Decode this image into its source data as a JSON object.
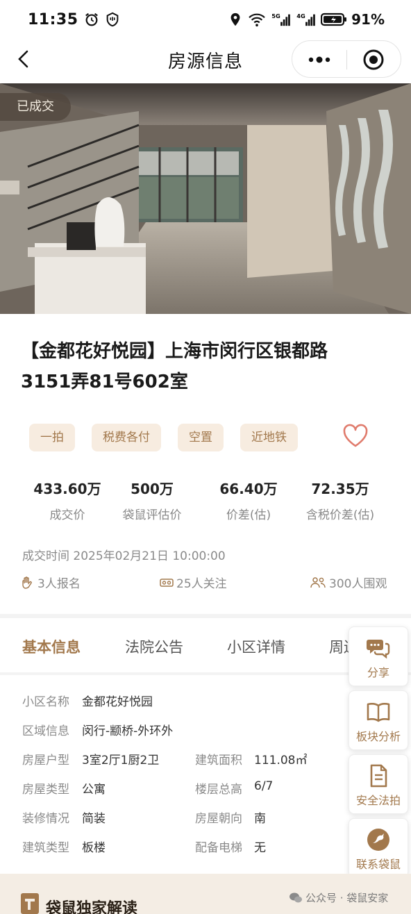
{
  "status_bar": {
    "time": "11:35",
    "battery": "91%"
  },
  "nav": {
    "title": "房源信息"
  },
  "photo": {
    "status_tag": "已成交"
  },
  "listing": {
    "title_line1": "【金都花好悦园】上海市闵行区银都路",
    "title_line2": "3151弄81号602室",
    "tags": [
      "一拍",
      "税费各付",
      "空置",
      "近地铁"
    ]
  },
  "stats": [
    {
      "value": "433.60万",
      "label": "成交价"
    },
    {
      "value": "500万",
      "label": "袋鼠评估价"
    },
    {
      "value": "66.40万",
      "label": "价差(估)"
    },
    {
      "value": "72.35万",
      "label": "含税价差(估)"
    }
  ],
  "deal_time": "成交时间 2025年02月21日 10:00:00",
  "counts": {
    "signup": "3人报名",
    "follow": "25人关注",
    "watch": "300人围观"
  },
  "tabs": [
    "基本信息",
    "法院公告",
    "小区详情",
    "周边"
  ],
  "info": {
    "community_label": "小区名称",
    "community": "金都花好悦园",
    "area_label": "区域信息",
    "area": "闵行-颛桥-外环外",
    "layout_label": "房屋户型",
    "layout": "3室2厅1厨2卫",
    "size_label": "建筑面积",
    "size": "111.08㎡",
    "type_label": "房屋类型",
    "type": "公寓",
    "floor_label": "楼层总高",
    "floor": "6/7",
    "deco_label": "装修情况",
    "deco": "简装",
    "orient_label": "房屋朝向",
    "orient": "南",
    "build_label": "建筑类型",
    "build": "板楼",
    "elevator_label": "配备电梯",
    "elevator": "无"
  },
  "side_actions": [
    "分享",
    "板块分析",
    "安全法拍",
    "联系袋鼠"
  ],
  "bottom": {
    "title": "袋鼠独家解读",
    "watermark": "公众号 · 袋鼠安家"
  },
  "colors": {
    "accent": "#a2784c",
    "tag_bg": "#f7ece0",
    "heart": "#e07b6c"
  }
}
